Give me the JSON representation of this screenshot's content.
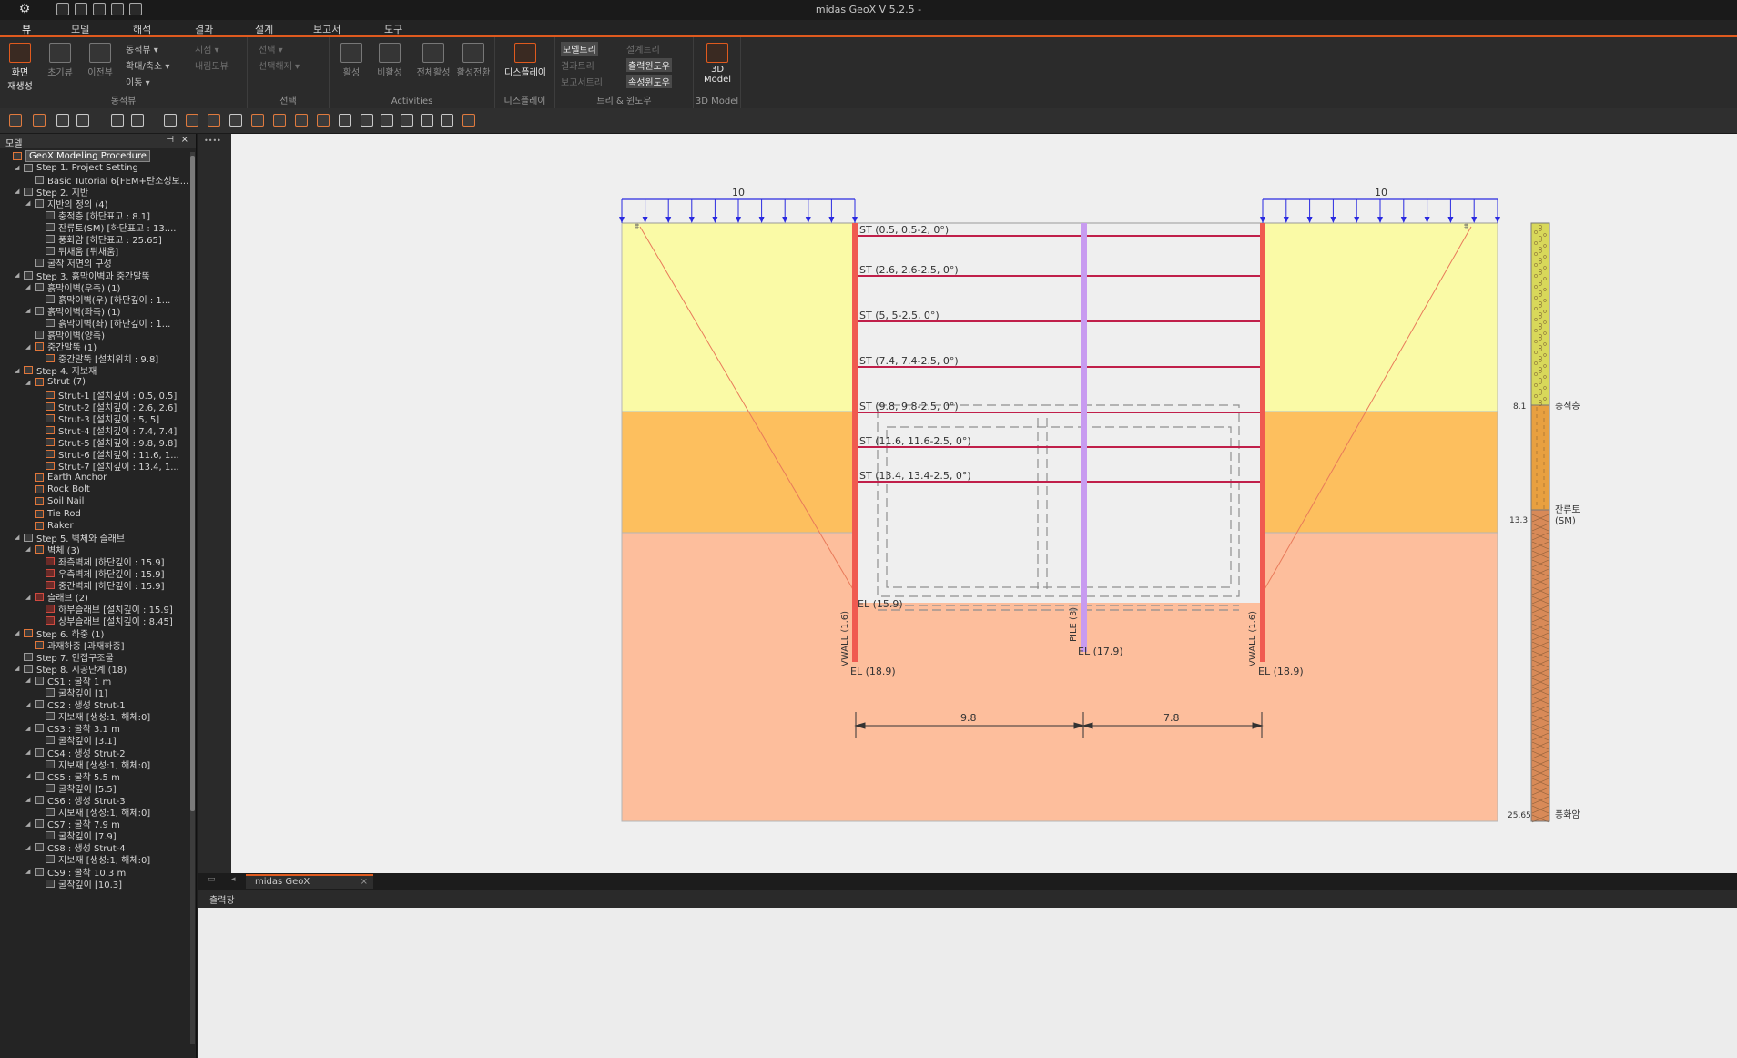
{
  "window": {
    "title": "midas GeoX V 5.2.5 -",
    "logo_glyph": "⚙"
  },
  "menu": {
    "tabs": [
      "뷰",
      "모델",
      "해석",
      "결과",
      "설계",
      "보고서",
      "도구"
    ],
    "active": "뷰"
  },
  "ribbon": {
    "view_group": {
      "label": "동적뷰",
      "buttons": {
        "regen": "화면\n재생성",
        "init": "초기뷰",
        "prev": "이전뷰"
      },
      "small": [
        "동적뷰 ▾",
        "확대/축소 ▾",
        "이동 ▾"
      ],
      "small_dim": [
        "시점 ▾",
        "내림도뷰"
      ]
    },
    "select_group": {
      "label": "선택",
      "items": [
        "선택 ▾",
        "선택해제 ▾"
      ]
    },
    "activities_group": {
      "label": "Activities",
      "buttons": [
        "활성",
        "비활성",
        "전체활성",
        "활성전환"
      ]
    },
    "display_group": {
      "label": "디스플레이",
      "button": "디스플레이"
    },
    "tree_group": {
      "label": "트리 & 윈도우",
      "items": [
        "모델트리",
        "결과트리",
        "보고서트리",
        "설계트리",
        "출력윈도우",
        "속성윈도우"
      ]
    },
    "model3d_group": {
      "label": "3D Model",
      "button": "3D\nModel"
    }
  },
  "sidebar": {
    "title": "모델",
    "pin": "⊣",
    "close": "×",
    "tree": [
      {
        "d": 0,
        "t": "",
        "i": "or",
        "label": "GeoX Modeling Procedure",
        "root": true
      },
      {
        "d": 1,
        "t": "◢",
        "i": "",
        "label": "Step 1. Project Setting"
      },
      {
        "d": 2,
        "t": "",
        "i": "",
        "label": "Basic Tutorial 6[FEM+탄소성보..."
      },
      {
        "d": 1,
        "t": "◢",
        "i": "",
        "label": "Step 2. 지반"
      },
      {
        "d": 2,
        "t": "◢",
        "i": "",
        "label": "지반의 정의 (4)"
      },
      {
        "d": 3,
        "t": "",
        "i": "",
        "label": "충적층 [하단표고 : 8.1]"
      },
      {
        "d": 3,
        "t": "",
        "i": "",
        "label": "잔류토(SM) [하단표고 : 13...."
      },
      {
        "d": 3,
        "t": "",
        "i": "",
        "label": "풍화암 [하단표고 : 25.65]"
      },
      {
        "d": 3,
        "t": "",
        "i": "",
        "label": "뒤채움 [뒤채움]"
      },
      {
        "d": 2,
        "t": "",
        "i": "",
        "label": "굴착 저면의 구성"
      },
      {
        "d": 1,
        "t": "◢",
        "i": "",
        "label": "Step 3. 흙막이벽과 중간말뚝"
      },
      {
        "d": 2,
        "t": "◢",
        "i": "",
        "label": "흙막이벽(우측) (1)"
      },
      {
        "d": 3,
        "t": "",
        "i": "",
        "label": "흙막이벽(우) [하단깊이 : 1..."
      },
      {
        "d": 2,
        "t": "◢",
        "i": "",
        "label": "흙막이벽(좌측) (1)"
      },
      {
        "d": 3,
        "t": "",
        "i": "",
        "label": "흙막이벽(좌) [하단깊이 : 1..."
      },
      {
        "d": 2,
        "t": "",
        "i": "",
        "label": "흙막이벽(양측)"
      },
      {
        "d": 2,
        "t": "◢",
        "i": "or",
        "label": "중간말뚝 (1)"
      },
      {
        "d": 3,
        "t": "",
        "i": "or",
        "label": "중간말뚝 [설치위치 : 9.8]"
      },
      {
        "d": 1,
        "t": "◢",
        "i": "or",
        "label": "Step 4. 지보재"
      },
      {
        "d": 2,
        "t": "◢",
        "i": "or",
        "label": "Strut (7)"
      },
      {
        "d": 3,
        "t": "",
        "i": "or",
        "label": "Strut-1 [설치깊이 : 0.5, 0.5]"
      },
      {
        "d": 3,
        "t": "",
        "i": "or",
        "label": "Strut-2 [설치깊이 : 2.6, 2.6]"
      },
      {
        "d": 3,
        "t": "",
        "i": "or",
        "label": "Strut-3 [설치깊이 : 5, 5]"
      },
      {
        "d": 3,
        "t": "",
        "i": "or",
        "label": "Strut-4 [설치깊이 : 7.4, 7.4]"
      },
      {
        "d": 3,
        "t": "",
        "i": "or",
        "label": "Strut-5 [설치깊이 : 9.8, 9.8]"
      },
      {
        "d": 3,
        "t": "",
        "i": "or",
        "label": "Strut-6 [설치깊이 : 11.6, 1..."
      },
      {
        "d": 3,
        "t": "",
        "i": "or",
        "label": "Strut-7 [설치깊이 : 13.4, 1..."
      },
      {
        "d": 2,
        "t": "",
        "i": "or",
        "label": "Earth Anchor"
      },
      {
        "d": 2,
        "t": "",
        "i": "or",
        "label": "Rock Bolt"
      },
      {
        "d": 2,
        "t": "",
        "i": "or",
        "label": "Soil Nail"
      },
      {
        "d": 2,
        "t": "",
        "i": "or",
        "label": "Tie Rod"
      },
      {
        "d": 2,
        "t": "",
        "i": "or",
        "label": "Raker"
      },
      {
        "d": 1,
        "t": "◢",
        "i": "",
        "label": "Step 5. 벽체와 슬래브"
      },
      {
        "d": 2,
        "t": "◢",
        "i": "or",
        "label": "벽체 (3)"
      },
      {
        "d": 3,
        "t": "",
        "i": "red",
        "label": "좌측벽체 [하단깊이 : 15.9]"
      },
      {
        "d": 3,
        "t": "",
        "i": "red",
        "label": "우측벽체 [하단깊이 : 15.9]"
      },
      {
        "d": 3,
        "t": "",
        "i": "red",
        "label": "중간벽체 [하단깊이 : 15.9]"
      },
      {
        "d": 2,
        "t": "◢",
        "i": "red",
        "label": "슬래브 (2)"
      },
      {
        "d": 3,
        "t": "",
        "i": "red",
        "label": "하부슬래브 [설치깊이 : 15.9]"
      },
      {
        "d": 3,
        "t": "",
        "i": "red",
        "label": "상부슬래브 [설치깊이 : 8.45]"
      },
      {
        "d": 1,
        "t": "◢",
        "i": "or",
        "label": "Step 6. 하중 (1)"
      },
      {
        "d": 2,
        "t": "",
        "i": "or",
        "label": "과재하중 [과재하중]"
      },
      {
        "d": 1,
        "t": "",
        "i": "",
        "label": "Step 7. 인접구조물"
      },
      {
        "d": 1,
        "t": "◢",
        "i": "",
        "label": "Step 8. 시공단계 (18)"
      },
      {
        "d": 2,
        "t": "◢",
        "i": "",
        "label": "CS1 : 굴착 1 m"
      },
      {
        "d": 3,
        "t": "",
        "i": "",
        "label": "굴착깊이 [1]"
      },
      {
        "d": 2,
        "t": "◢",
        "i": "",
        "label": "CS2 : 생성 Strut-1"
      },
      {
        "d": 3,
        "t": "",
        "i": "",
        "label": "지보재 [생성:1, 해체:0]"
      },
      {
        "d": 2,
        "t": "◢",
        "i": "",
        "label": "CS3 : 굴착 3.1 m"
      },
      {
        "d": 3,
        "t": "",
        "i": "",
        "label": "굴착깊이 [3.1]"
      },
      {
        "d": 2,
        "t": "◢",
        "i": "",
        "label": "CS4 : 생성 Strut-2"
      },
      {
        "d": 3,
        "t": "",
        "i": "",
        "label": "지보재 [생성:1, 해체:0]"
      },
      {
        "d": 2,
        "t": "◢",
        "i": "",
        "label": "CS5 : 굴착 5.5 m"
      },
      {
        "d": 3,
        "t": "",
        "i": "",
        "label": "굴착깊이 [5.5]"
      },
      {
        "d": 2,
        "t": "◢",
        "i": "",
        "label": "CS6 : 생성 Strut-3"
      },
      {
        "d": 3,
        "t": "",
        "i": "",
        "label": "지보재 [생성:1, 해체:0]"
      },
      {
        "d": 2,
        "t": "◢",
        "i": "",
        "label": "CS7 : 굴착 7.9 m"
      },
      {
        "d": 3,
        "t": "",
        "i": "",
        "label": "굴착깊이 [7.9]"
      },
      {
        "d": 2,
        "t": "◢",
        "i": "",
        "label": "CS8 : 생성 Strut-4"
      },
      {
        "d": 3,
        "t": "",
        "i": "",
        "label": "지보재 [생성:1, 해체:0]"
      },
      {
        "d": 2,
        "t": "◢",
        "i": "",
        "label": "CS9 : 굴착 10.3 m"
      },
      {
        "d": 3,
        "t": "",
        "i": "",
        "label": "굴착깊이 [10.3]"
      }
    ]
  },
  "drawing": {
    "colors": {
      "layer1": "#fafaa6",
      "layer2": "#fdbf5e",
      "layer3": "#fdbe9c",
      "wall": "#f05a50",
      "strut": "#c01f4a",
      "pile": "#c89bf0",
      "load": "#2a2ae0"
    },
    "load_left": "10",
    "load_right": "10",
    "struts": [
      "ST (0.5, 0.5-2, 0°)",
      "ST (2.6, 2.6-2.5, 0°)",
      "ST (5, 5-2.5, 0°)",
      "ST (7.4, 7.4-2.5, 0°)",
      "ST (9.8, 9.8-2.5, 0°)",
      "ST (11.6, 11.6-2.5, 0°)",
      "ST (13.4, 13.4-2.5, 0°)"
    ],
    "el_bottom": "EL (15.9)",
    "wall_left_label": "VWALL (1.6)",
    "wall_right_label": "VWALL (1.6)",
    "wall_left_el": "EL (18.9)",
    "wall_right_el": "EL (18.9)",
    "pile_label": "PILE (3)",
    "pile_el": "EL (17.9)",
    "dim_left": "9.8",
    "dim_right": "7.8",
    "borehole": [
      {
        "depth": "8.1",
        "name": "충적층"
      },
      {
        "depth": "13.3",
        "name": "잔류토\n(SM)"
      },
      {
        "depth": "25.65",
        "name": "풍화암"
      }
    ]
  },
  "tabs": {
    "doc": "midas GeoX",
    "close": "×"
  },
  "output": {
    "title": "출력창"
  }
}
